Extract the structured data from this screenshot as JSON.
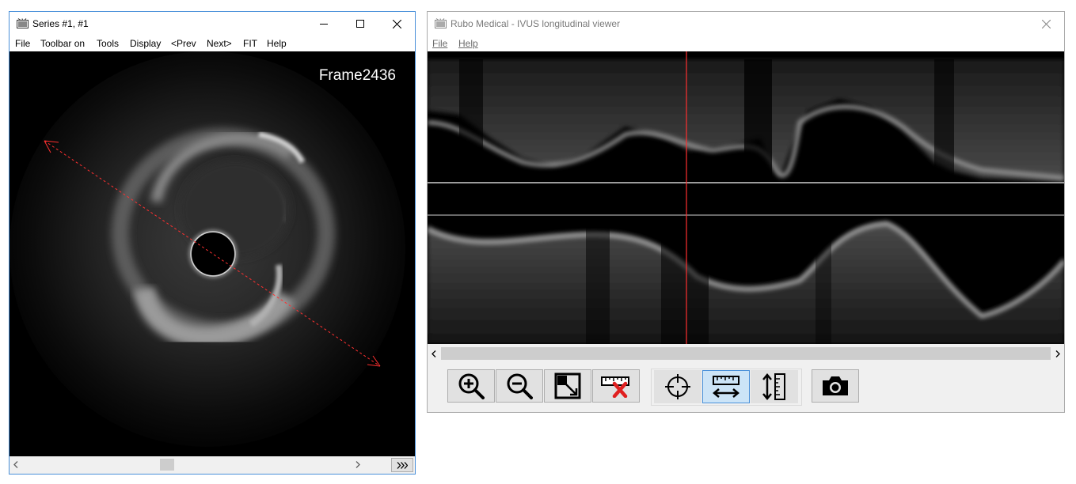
{
  "series_window": {
    "title": "Series #1, #1",
    "menu": [
      "File",
      "Toolbar on",
      "Tools",
      "Display",
      "<Prev",
      "Next>",
      "FIT",
      "Help"
    ],
    "frame_label": "Frame2436",
    "scroll_right_icon": "chevron-right-icon",
    "scroll_left_icon": "chevron-left-icon",
    "fast_forward_icon": "fast-forward-icon"
  },
  "viewer_window": {
    "title": "Rubo Medical - IVUS longitudinal viewer",
    "menu": [
      "File",
      "Help"
    ],
    "marker_color": "#ff3030",
    "toolbar": {
      "group1": [
        "zoom-in-icon",
        "zoom-out-icon",
        "fit-to-window-icon",
        "delete-measure-icon"
      ],
      "group2": [
        "crosshair-icon",
        "horizontal-measure-icon",
        "vertical-measure-icon"
      ],
      "group3": [
        "camera-icon"
      ],
      "active_tool": "horizontal-measure-icon"
    }
  }
}
